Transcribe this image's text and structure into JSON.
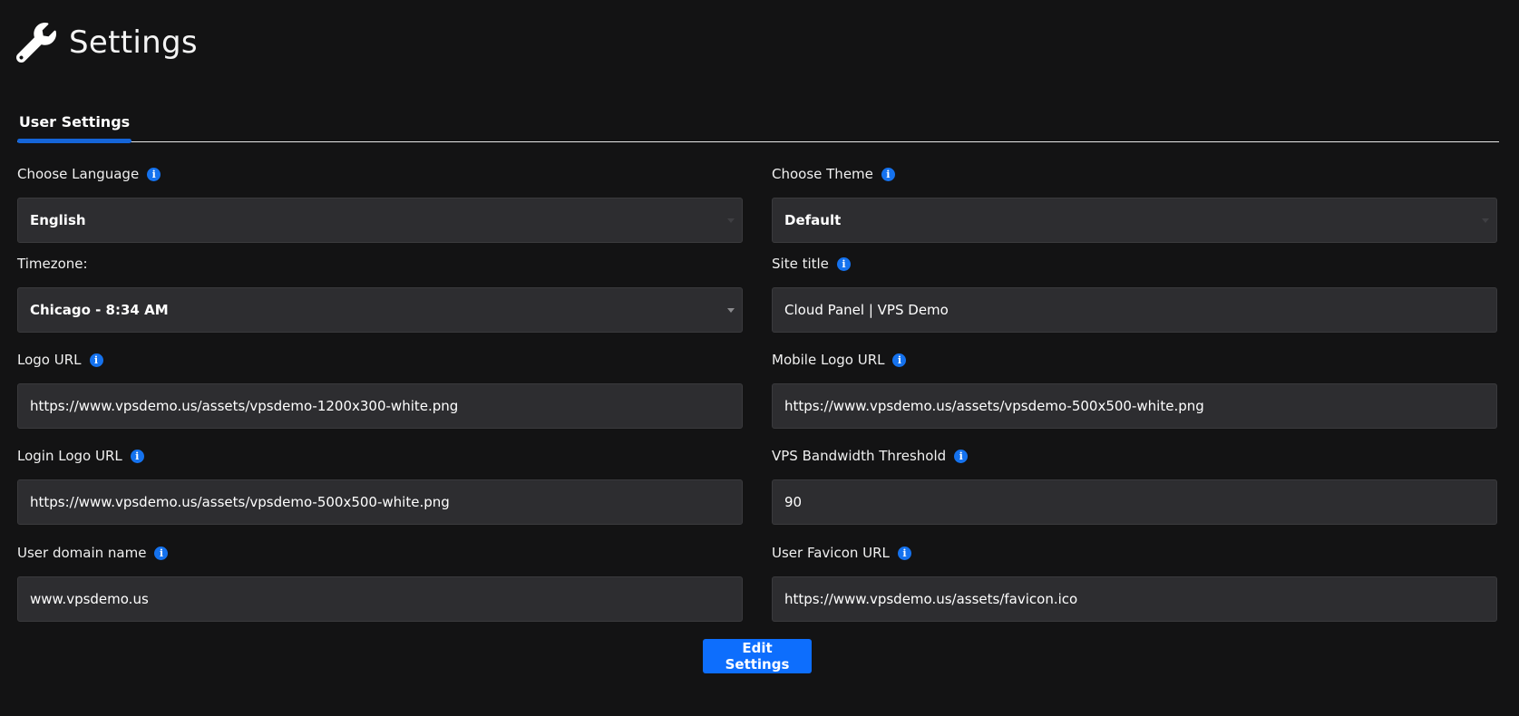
{
  "header": {
    "title": "Settings",
    "icon": "wrench-icon"
  },
  "tabs": [
    {
      "label": "User Settings",
      "active": true
    }
  ],
  "colors": {
    "background": "#131314",
    "input_background": "#2d2d30",
    "accent": "#0d6efd",
    "info_icon": "#1572ee"
  },
  "fields": {
    "language": {
      "label": "Choose Language",
      "value": "English",
      "type": "select"
    },
    "theme": {
      "label": "Choose Theme",
      "value": "Default",
      "type": "select"
    },
    "timezone": {
      "label": "Timezone:",
      "value": "Chicago - 8:34 AM",
      "type": "select"
    },
    "site_title": {
      "label": "Site title",
      "value": "Cloud Panel | VPS Demo",
      "type": "text"
    },
    "logo_url": {
      "label": "Logo URL",
      "value": "https://www.vpsdemo.us/assets/vpsdemo-1200x300-white.png",
      "type": "text"
    },
    "mobile_logo_url": {
      "label": "Mobile Logo URL",
      "value": "https://www.vpsdemo.us/assets/vpsdemo-500x500-white.png",
      "type": "text"
    },
    "login_logo_url": {
      "label": "Login Logo URL",
      "value": "https://www.vpsdemo.us/assets/vpsdemo-500x500-white.png",
      "type": "text"
    },
    "bandwidth_threshold": {
      "label": "VPS Bandwidth Threshold",
      "value": "90",
      "type": "text"
    },
    "user_domain": {
      "label": "User domain name",
      "value": "www.vpsdemo.us",
      "type": "text"
    },
    "favicon_url": {
      "label": "User Favicon URL",
      "value": "https://www.vpsdemo.us/assets/favicon.ico",
      "type": "text"
    }
  },
  "actions": {
    "edit_label": "Edit Settings"
  }
}
